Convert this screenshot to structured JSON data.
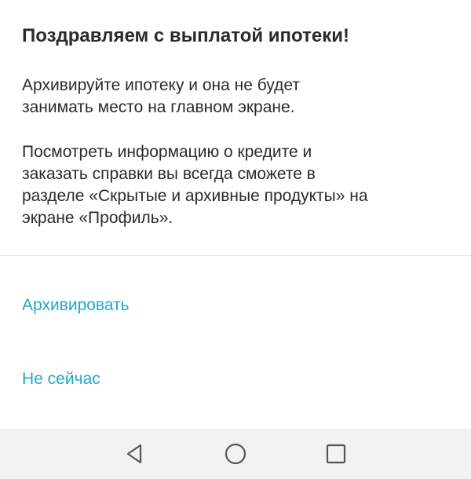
{
  "dialog": {
    "title": "Поздравляем с выплатой ипотеки!",
    "paragraph1_line1": "Архивируйте ипотеку и она не будет",
    "paragraph1_line2": "занимать место на главном экране.",
    "paragraph2_line1": "Посмотреть информацию о кредите и",
    "paragraph2_line2": "заказать справки вы всегда сможете в",
    "paragraph2_line3": "разделе «Скрытые и архивные продукты» на",
    "paragraph2_line4": "экране «Профиль».",
    "archive_label": "Архивировать",
    "not_now_label": "Не сейчас"
  },
  "navbar": {
    "icons": [
      "back-icon",
      "home-icon",
      "recent-apps-icon"
    ]
  },
  "colors": {
    "accent": "#1fa8cc",
    "text": "#2b2b2b",
    "navbar_bg": "#f2f2f2",
    "divider": "#e3e3e3"
  }
}
